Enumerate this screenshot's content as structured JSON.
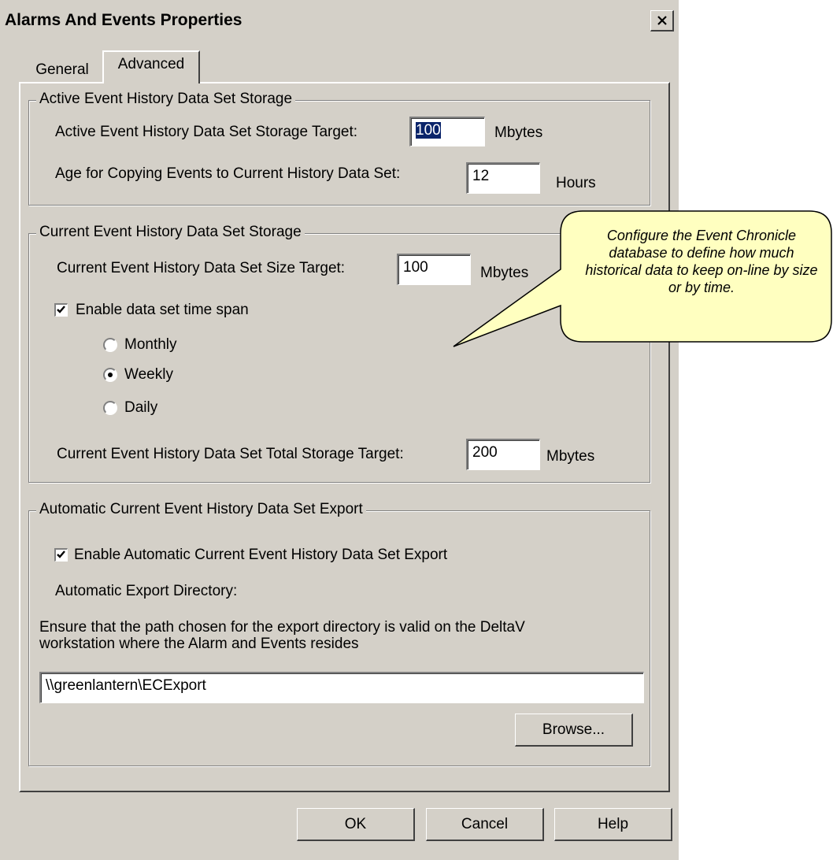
{
  "window": {
    "title": "Alarms And Events Properties"
  },
  "tabs": [
    {
      "label": "General"
    },
    {
      "label": "Advanced"
    }
  ],
  "active_storage": {
    "legend": "Active Event History Data Set Storage",
    "target_label": "Active Event History Data Set Storage Target:",
    "target_value": "100",
    "target_unit": "Mbytes",
    "age_label": "Age for Copying Events to Current History Data Set:",
    "age_value": "12",
    "age_unit": "Hours"
  },
  "current_storage": {
    "legend": "Current Event History Data Set Storage",
    "size_label": "Current Event History Data Set Size Target:",
    "size_value": "100",
    "size_unit": "Mbytes",
    "timespan_label": "Enable data set time span",
    "timespan_checked": true,
    "options": [
      "Monthly",
      "Weekly",
      "Daily"
    ],
    "selected_option": "Weekly",
    "total_label": "Current Event History Data Set Total Storage Target:",
    "total_value": "200",
    "total_unit": "Mbytes"
  },
  "export": {
    "legend": "Automatic Current Event History Data Set Export",
    "enable_label": "Enable Automatic Current Event History Data Set Export",
    "enable_checked": true,
    "dir_label": "Automatic Export Directory:",
    "note_line1": "Ensure that the path chosen for the export directory is valid on the DeltaV",
    "note_line2": "workstation where the Alarm and Events resides",
    "path_value": "\\\\greenlantern\\ECExport",
    "browse_label": "Browse..."
  },
  "buttons": {
    "ok": "OK",
    "cancel": "Cancel",
    "help": "Help"
  },
  "callout": {
    "text": "Configure the Event Chronicle database to define how much historical data to keep on-line by size or by time.",
    "fill": "#ffffc0"
  }
}
